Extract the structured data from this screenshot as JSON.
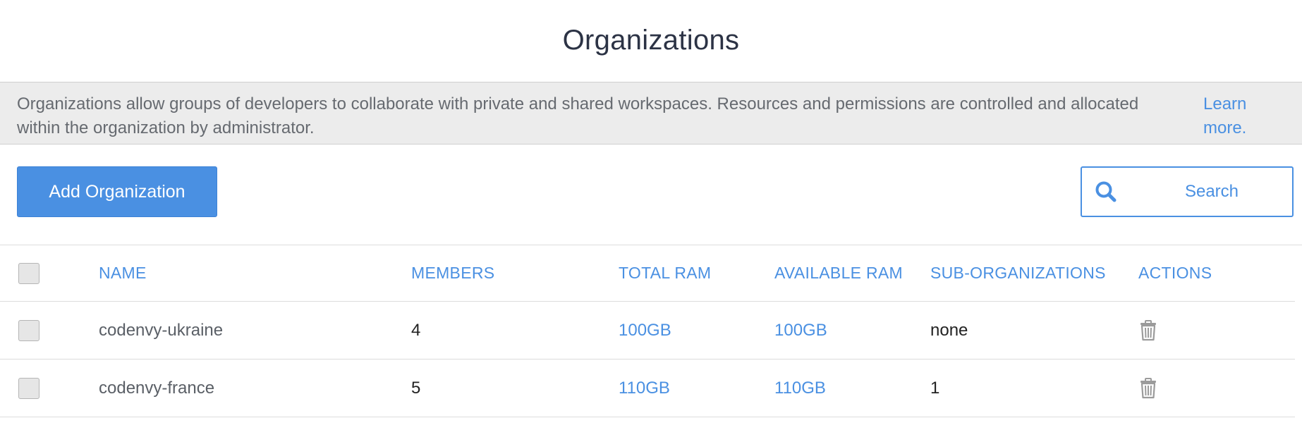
{
  "page": {
    "title": "Organizations"
  },
  "info": {
    "text": "Organizations allow groups of developers to collaborate with private and shared workspaces. Resources and permissions are controlled and allocated within the organization by administrator.",
    "learn_more": "Learn more."
  },
  "toolbar": {
    "add_label": "Add Organization",
    "search_placeholder": "Search",
    "search_icon": "search-icon"
  },
  "table": {
    "headers": {
      "name": "NAME",
      "members": "MEMBERS",
      "total_ram": "TOTAL RAM",
      "available_ram": "AVAILABLE RAM",
      "sub_organizations": "SUB-ORGANIZATIONS",
      "actions": "ACTIONS"
    },
    "rows": [
      {
        "name": "codenvy-ukraine",
        "members": "4",
        "total_ram": "100GB",
        "available_ram": "100GB",
        "sub_organizations": "none",
        "action_icon": "trash-icon"
      },
      {
        "name": "codenvy-france",
        "members": "5",
        "total_ram": "110GB",
        "available_ram": "110GB",
        "sub_organizations": "1",
        "action_icon": "trash-icon"
      }
    ]
  },
  "colors": {
    "accent": "#4a90e2",
    "title": "#2c3345",
    "info_bg": "#ececec"
  }
}
